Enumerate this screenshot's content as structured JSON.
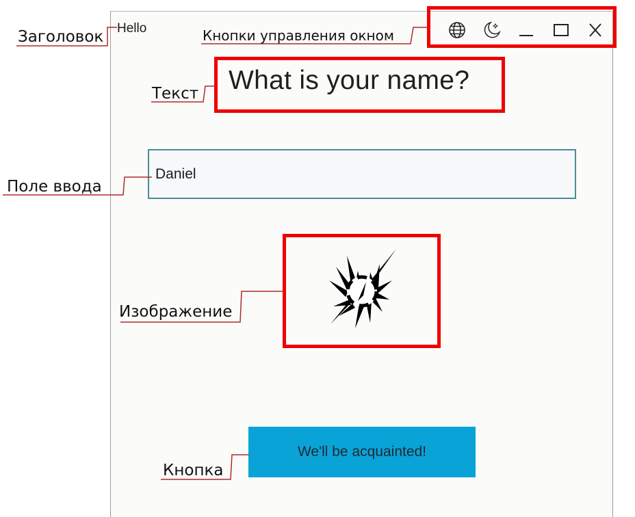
{
  "window": {
    "title": "Hello",
    "controls": [
      {
        "name": "language",
        "icon": "globe-icon"
      },
      {
        "name": "theme",
        "icon": "moon-icon"
      },
      {
        "name": "minimize",
        "icon": "minimize-icon"
      },
      {
        "name": "maximize",
        "icon": "maximize-icon"
      },
      {
        "name": "close",
        "icon": "close-icon"
      }
    ]
  },
  "content": {
    "prompt": "What is your name?",
    "name_input_value": "Daniel",
    "image_icon": "compass-burst-icon",
    "button_label": "We'll be acquainted!"
  },
  "annotations": {
    "title_label": "Заголовок",
    "window_controls_label": "Кнопки управления окном",
    "text_label": "Текст",
    "input_label": "Поле ввода",
    "image_label": "Изображение",
    "button_label": "Кнопка"
  },
  "colors": {
    "highlight": "#ee0000",
    "leader_line": "#b02a2a",
    "button_background": "#0aa3d8",
    "input_border": "#4a8c95",
    "window_background": "#fbfbf9"
  }
}
